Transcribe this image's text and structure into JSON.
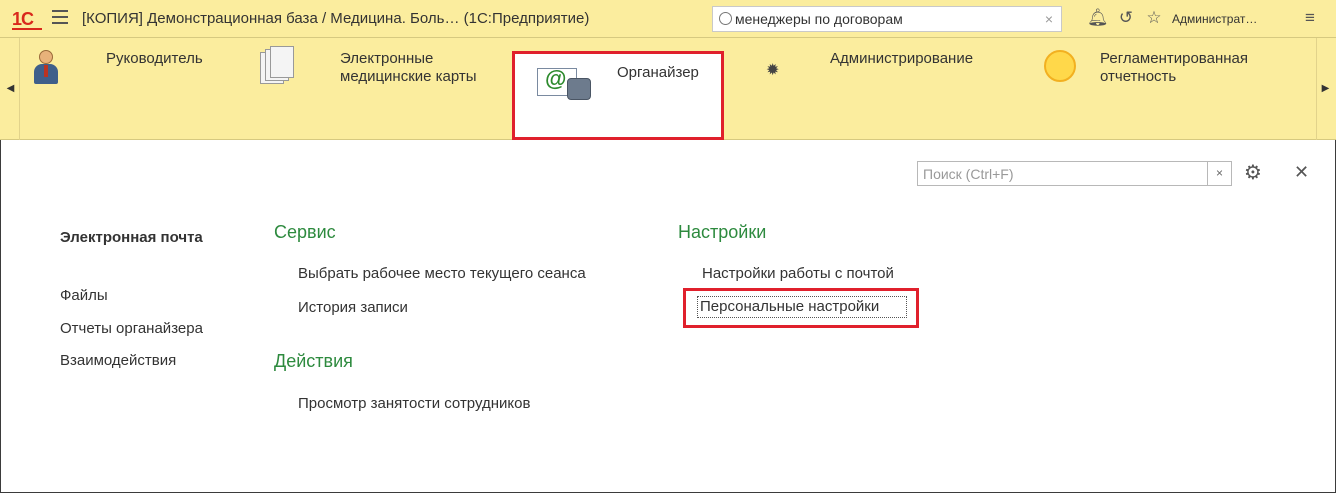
{
  "app": {
    "logo": "1С",
    "title": "[КОПИЯ] Демонстрационная база / Медицина. Боль…  (1С:Предприятие)"
  },
  "top_search": {
    "value": "менеджеры по договорам"
  },
  "user": {
    "name": "Администрат…"
  },
  "sections": [
    {
      "label": "Руководитель",
      "icon": "manager-icon"
    },
    {
      "label": "Электронные\nмедицинские карты",
      "icon": "documents-icon"
    },
    {
      "label": "Органайзер",
      "icon": "mail-phone-icon",
      "active": true
    },
    {
      "label": "Администрирование",
      "icon": "gear-icon"
    },
    {
      "label": "Регламентированная\nотчетность",
      "icon": "sun-icon"
    }
  ],
  "content_search": {
    "placeholder": "Поиск (Ctrl+F)"
  },
  "nav": [
    {
      "label": "Электронная почта",
      "current": true
    },
    {
      "label": "Файлы"
    },
    {
      "label": "Отчеты органайзера"
    },
    {
      "label": "Взаимодействия"
    }
  ],
  "groups": {
    "service": {
      "title": "Сервис",
      "items": [
        "Выбрать рабочее место текущего сеанса",
        "История записи"
      ]
    },
    "actions": {
      "title": "Действия",
      "items": [
        "Просмотр занятости сотрудников"
      ]
    },
    "settings": {
      "title": "Настройки",
      "items": [
        "Настройки работы с почтой",
        "Персональные настройки"
      ]
    }
  },
  "colors": {
    "panel": "#fbed9e",
    "highlight": "#e0202c",
    "group_title": "#2d8a3e"
  }
}
